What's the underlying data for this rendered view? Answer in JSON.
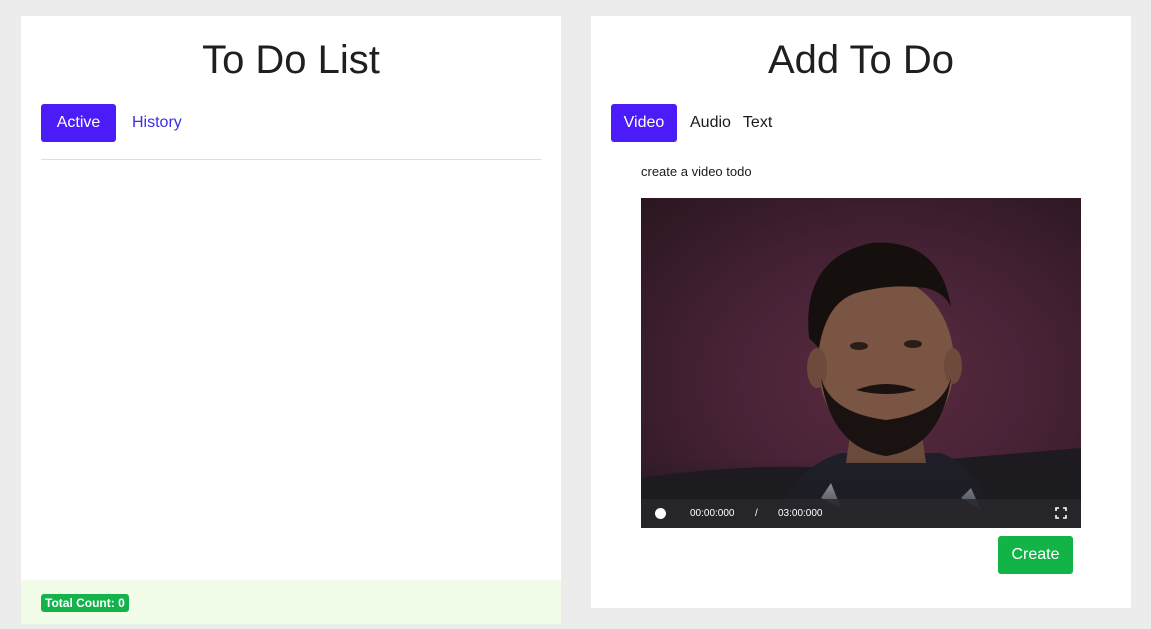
{
  "todo_list": {
    "title": "To Do List",
    "tabs": [
      {
        "label": "Active",
        "selected": true
      },
      {
        "label": "History",
        "selected": false
      }
    ],
    "items": [],
    "footer": {
      "total_count_label": "Total Count: 0"
    }
  },
  "add_todo": {
    "title": "Add To Do",
    "tabs": [
      {
        "label": "Video",
        "selected": true
      },
      {
        "label": "Audio",
        "selected": false
      },
      {
        "label": "Text",
        "selected": false
      }
    ],
    "caption": "create a video todo",
    "video": {
      "current_time": "00:00:000",
      "separator": "/",
      "total_time": "03:00:000"
    },
    "create_label": "Create"
  },
  "colors": {
    "accent": "#4b1cf7",
    "link": "#3b2ee3",
    "success": "#12b448",
    "footer_bg": "#f1fde8",
    "page_bg": "#ececec"
  }
}
